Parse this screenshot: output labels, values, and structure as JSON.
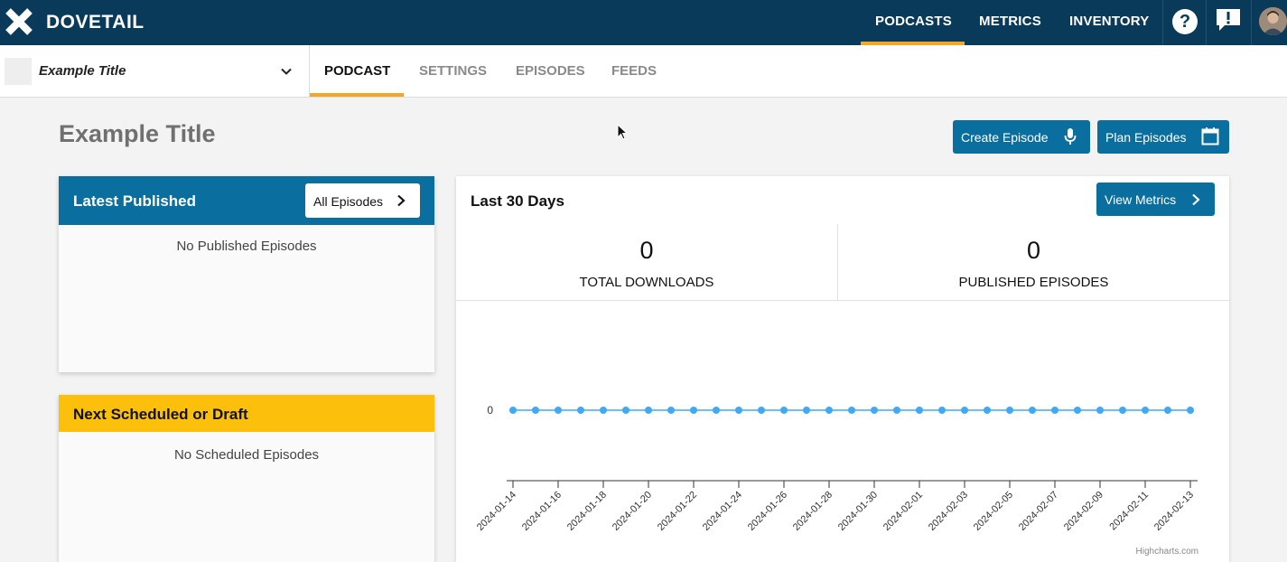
{
  "brand": {
    "name": "DOVETAIL"
  },
  "topnav": {
    "items": [
      "PODCASTS",
      "METRICS",
      "INVENTORY"
    ],
    "active": "PODCASTS"
  },
  "podcast_select": {
    "value": "Example Title"
  },
  "tabs": {
    "items": [
      "PODCAST",
      "SETTINGS",
      "EPISODES",
      "FEEDS"
    ],
    "active": "PODCAST"
  },
  "page": {
    "title": "Example Title",
    "create_episode": "Create Episode",
    "plan_episodes": "Plan Episodes"
  },
  "latest": {
    "title": "Latest Published",
    "button": "All Episodes",
    "empty": "No Published Episodes"
  },
  "scheduled": {
    "title": "Next Scheduled or Draft",
    "empty": "No Scheduled Episodes"
  },
  "metrics": {
    "title": "Last 30 Days",
    "button": "View Metrics",
    "total_downloads_value": "0",
    "total_downloads_label": "TOTAL DOWNLOADS",
    "published_value": "0",
    "published_label": "PUBLISHED EPISODES",
    "credit": "Highcharts.com"
  },
  "colors": {
    "nav_bg": "#0a3a5a",
    "accent": "#f5a623",
    "primary": "#0a6f9e",
    "scheduled": "#fcbf0b",
    "series": "#3fa9f5"
  },
  "chart_data": {
    "type": "line",
    "x": [
      "2024-01-14",
      "2024-01-15",
      "2024-01-16",
      "2024-01-17",
      "2024-01-18",
      "2024-01-19",
      "2024-01-20",
      "2024-01-21",
      "2024-01-22",
      "2024-01-23",
      "2024-01-24",
      "2024-01-25",
      "2024-01-26",
      "2024-01-27",
      "2024-01-28",
      "2024-01-29",
      "2024-01-30",
      "2024-01-31",
      "2024-02-01",
      "2024-02-02",
      "2024-02-03",
      "2024-02-04",
      "2024-02-05",
      "2024-02-06",
      "2024-02-07",
      "2024-02-08",
      "2024-02-09",
      "2024-02-10",
      "2024-02-11",
      "2024-02-12",
      "2024-02-13"
    ],
    "values": [
      0,
      0,
      0,
      0,
      0,
      0,
      0,
      0,
      0,
      0,
      0,
      0,
      0,
      0,
      0,
      0,
      0,
      0,
      0,
      0,
      0,
      0,
      0,
      0,
      0,
      0,
      0,
      0,
      0,
      0,
      0
    ],
    "tick_labels": [
      "2024-01-14",
      "2024-01-16",
      "2024-01-18",
      "2024-01-20",
      "2024-01-22",
      "2024-01-24",
      "2024-01-26",
      "2024-01-28",
      "2024-01-30",
      "2024-02-01",
      "2024-02-03",
      "2024-02-05",
      "2024-02-07",
      "2024-02-09",
      "2024-02-11",
      "2024-02-13"
    ],
    "y_ticks": [
      "0"
    ],
    "grid": false
  }
}
